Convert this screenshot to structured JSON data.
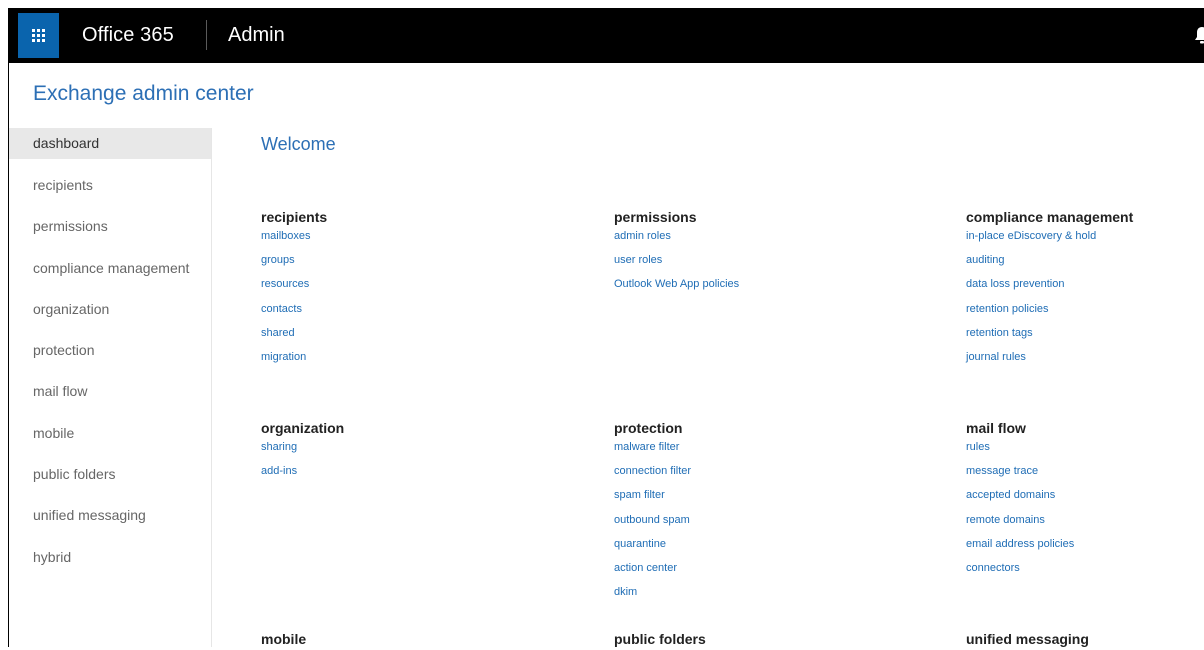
{
  "topbar": {
    "brand": "Office 365",
    "app_name": "Admin"
  },
  "app_title": "Exchange admin center",
  "sidebar": {
    "items": [
      {
        "label": "dashboard",
        "active": true
      },
      {
        "label": "recipients"
      },
      {
        "label": "permissions"
      },
      {
        "label": "compliance management"
      },
      {
        "label": "organization"
      },
      {
        "label": "protection"
      },
      {
        "label": "mail flow"
      },
      {
        "label": "mobile"
      },
      {
        "label": "public folders"
      },
      {
        "label": "unified messaging"
      },
      {
        "label": "hybrid"
      }
    ]
  },
  "main": {
    "welcome": "Welcome",
    "sections": [
      {
        "title": "recipients",
        "links": [
          "mailboxes",
          "groups",
          "resources",
          "contacts",
          "shared",
          "migration"
        ]
      },
      {
        "title": "permissions",
        "links": [
          "admin roles",
          "user roles",
          "Outlook Web App policies"
        ]
      },
      {
        "title": "compliance management",
        "links": [
          "in-place eDiscovery & hold",
          "auditing",
          "data loss prevention",
          "retention policies",
          "retention tags",
          "journal rules"
        ]
      },
      {
        "title": "organization",
        "links": [
          "sharing",
          "add-ins"
        ]
      },
      {
        "title": "protection",
        "links": [
          "malware filter",
          "connection filter",
          "spam filter",
          "outbound spam",
          "quarantine",
          "action center",
          "dkim"
        ]
      },
      {
        "title": "mail flow",
        "links": [
          "rules",
          "message trace",
          "accepted domains",
          "remote domains",
          "email address policies",
          "connectors"
        ]
      },
      {
        "title": "mobile",
        "links": []
      },
      {
        "title": "public folders",
        "links": []
      },
      {
        "title": "unified messaging",
        "links": []
      }
    ]
  },
  "colors": {
    "topbar": "#000000",
    "waffle": "#0a64ad",
    "accent": "#2c6fb5",
    "link": "#1f6db5",
    "nav_active_bg": "#e8e8e8"
  },
  "icons": {
    "app_launcher": "waffle-icon",
    "notifications": "bell-icon"
  }
}
